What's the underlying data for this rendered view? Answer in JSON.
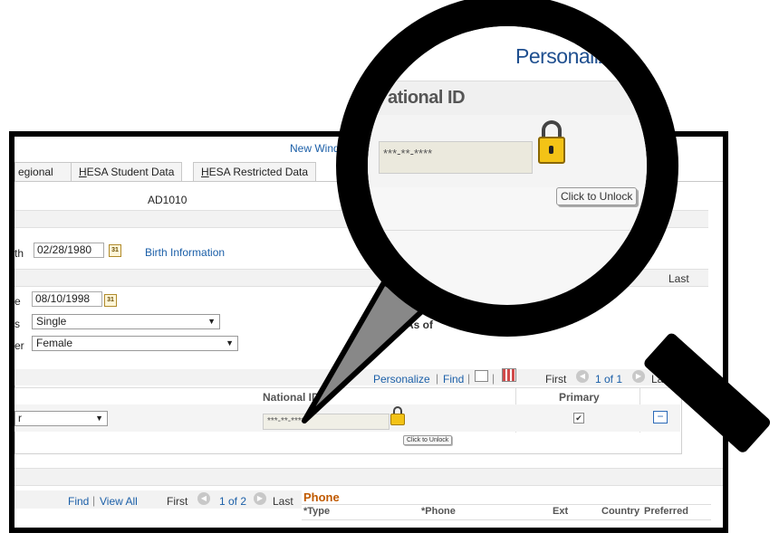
{
  "window": {
    "new_window_link": "New Window"
  },
  "tabs": [
    {
      "pre": "egional",
      "key": "",
      "rest": ""
    },
    {
      "pre": "",
      "key": "H",
      "rest": "ESA Student Data"
    },
    {
      "pre": "",
      "key": "H",
      "rest": "ESA Restricted Data"
    }
  ],
  "person": {
    "id": "AD1010"
  },
  "birth": {
    "label_partial": "th",
    "date": "02/28/1980",
    "info_link": "Birth Information"
  },
  "status_section": {
    "date_label_partial": "e",
    "date": "08/10/1998",
    "marital_label_partial": "s",
    "marital_value": "Single",
    "gender_label_partial": "er",
    "gender_value": "Female",
    "as_of_partial": "As of",
    "last_partial": "Last"
  },
  "national_id_grid": {
    "toolbar": {
      "personalize": "Personalize",
      "find": "Find",
      "first": "First",
      "range": "1 of 1",
      "last": "Last"
    },
    "headers": {
      "national_id": "National ID",
      "primary": "Primary"
    },
    "row": {
      "type_partial": "r",
      "national_id": "***-**-****",
      "primary_checked": true,
      "unlock_label": "Click to Unlock"
    }
  },
  "address_grid": {
    "toolbar": {
      "find": "Find",
      "view_all": "View All",
      "first": "First",
      "range": "1 of 2",
      "last": "Last"
    }
  },
  "phone_grid": {
    "title": "Phone",
    "headers": {
      "type": "*Type",
      "phone": "*Phone",
      "ext": "Ext",
      "country": "Country",
      "preferred": "Preferred"
    }
  },
  "magnified": {
    "personalize": "Personalize",
    "national_id_header": "ational ID",
    "national_id": "***-**-****",
    "unlock_label": "Click to Unlock"
  },
  "colors": {
    "link": "#1b5fa8",
    "lock": "#f3c316",
    "phone_title": "#c05a00"
  },
  "icons": [
    "calendar-icon",
    "lock-icon",
    "checkbox-icon",
    "minus-icon",
    "zoom-icon",
    "grid-icon",
    "prev-icon",
    "next-icon",
    "magnifier-icon"
  ]
}
